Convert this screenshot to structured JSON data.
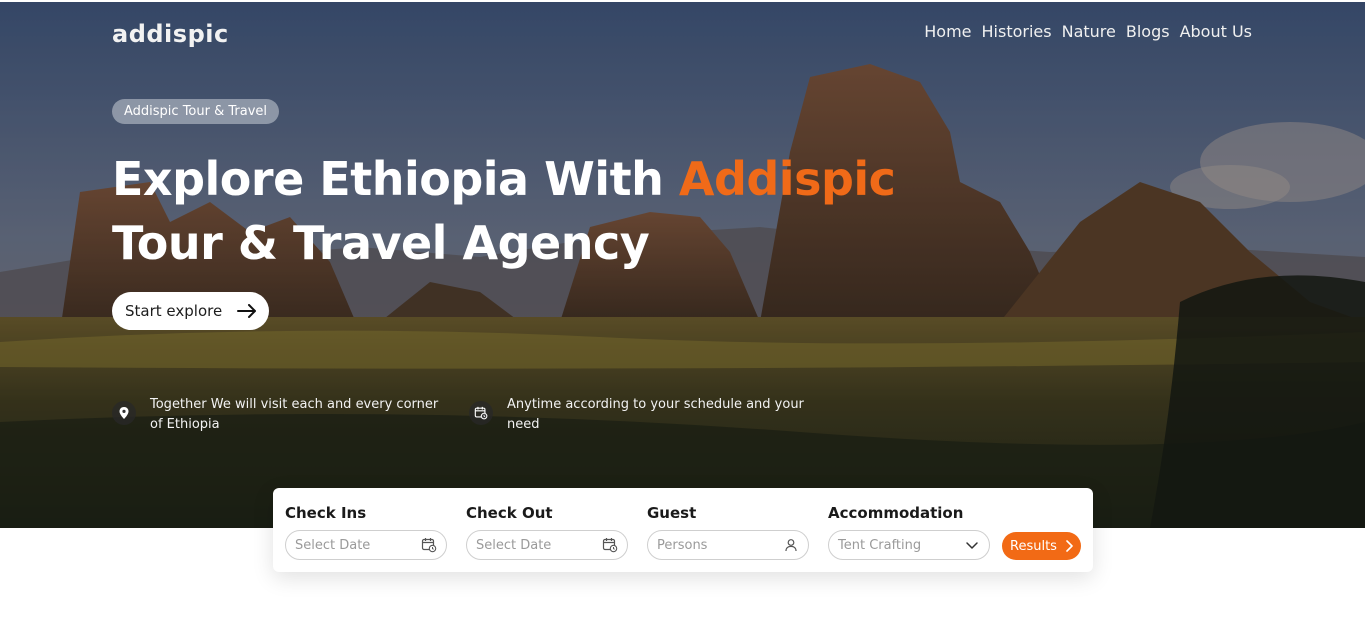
{
  "header": {
    "logo": "addispic",
    "nav": [
      "Home",
      "Histories",
      "Nature",
      "Blogs",
      "About Us"
    ]
  },
  "hero": {
    "badge": "Addispic Tour & Travel",
    "headline_before": "Explore Ethiopia With ",
    "headline_accent": "Addispic",
    "headline_after": " Tour & Travel Agency",
    "cta_label": "Start explore",
    "features": [
      {
        "icon": "location-pin-icon",
        "text": "Together We will visit each and every corner of Ethiopia"
      },
      {
        "icon": "calendar-clock-icon",
        "text": "Anytime according to your schedule and your need"
      }
    ]
  },
  "search": {
    "fields": [
      {
        "label": "Check Ins",
        "placeholder": "Select Date",
        "icon": "calendar-clock-icon"
      },
      {
        "label": "Check Out",
        "placeholder": "Select Date",
        "icon": "calendar-clock-icon"
      },
      {
        "label": "Guest",
        "placeholder": "Persons",
        "icon": "user-icon"
      },
      {
        "label": "Accommodation",
        "placeholder": "Tent Crafting",
        "icon": "chevron-down-icon"
      }
    ],
    "results_label": "Results"
  },
  "colors": {
    "accent": "#f06a18",
    "results_button": "#f26a15",
    "text_dark": "#1a1a1a"
  }
}
